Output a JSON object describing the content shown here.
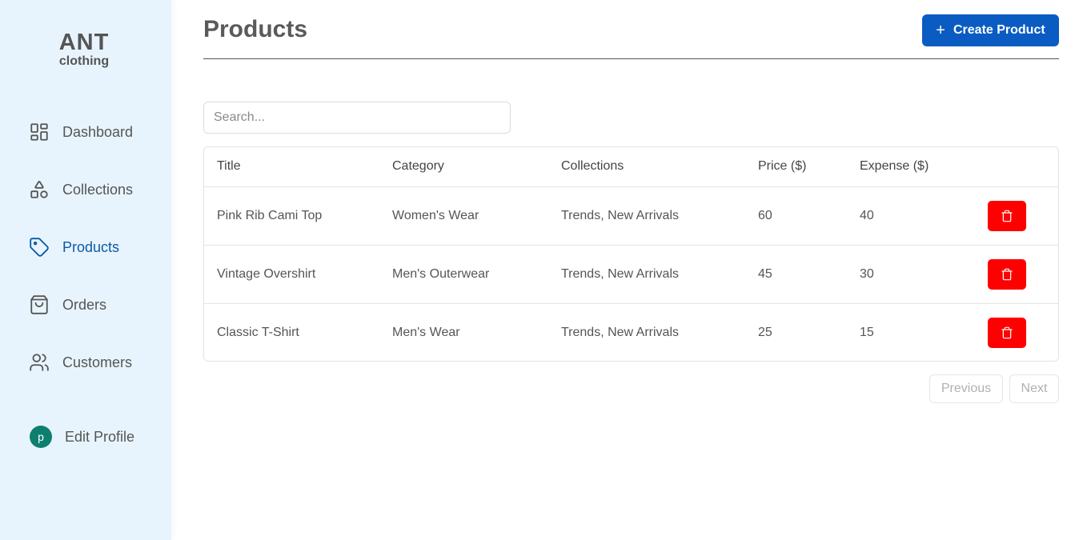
{
  "brand": {
    "name": "ANT",
    "tagline": "clothing"
  },
  "sidebar": {
    "items": [
      {
        "label": "Dashboard",
        "icon": "dashboard-icon",
        "active": false
      },
      {
        "label": "Collections",
        "icon": "shapes-icon",
        "active": false
      },
      {
        "label": "Products",
        "icon": "tag-icon",
        "active": true
      },
      {
        "label": "Orders",
        "icon": "shopping-bag-icon",
        "active": false
      },
      {
        "label": "Customers",
        "icon": "users-icon",
        "active": false
      }
    ],
    "profile": {
      "avatar_letter": "p",
      "label": "Edit Profile"
    }
  },
  "header": {
    "title": "Products",
    "create_label": "Create Product"
  },
  "search": {
    "placeholder": "Search..."
  },
  "table": {
    "columns": [
      "Title",
      "Category",
      "Collections",
      "Price ($)",
      "Expense ($)"
    ],
    "rows": [
      {
        "title": "Pink Rib Cami Top",
        "category": "Women's Wear",
        "collections": "Trends, New Arrivals",
        "price": "60",
        "expense": "40"
      },
      {
        "title": "Vintage Overshirt",
        "category": "Men's Outerwear",
        "collections": "Trends, New Arrivals",
        "price": "45",
        "expense": "30"
      },
      {
        "title": "Classic T-Shirt",
        "category": "Men's Wear",
        "collections": "Trends, New Arrivals",
        "price": "25",
        "expense": "15"
      }
    ]
  },
  "pagination": {
    "previous_label": "Previous",
    "next_label": "Next"
  },
  "colors": {
    "accent": "#0a5cc2",
    "active_nav": "#0a5aa8",
    "danger": "#ff0000",
    "sidebar_bg": "#e8f4fd",
    "avatar": "#0e7f6e"
  }
}
